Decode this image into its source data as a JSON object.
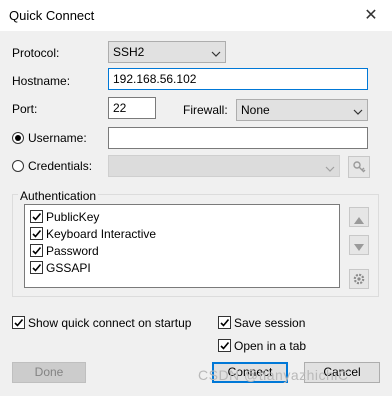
{
  "window": {
    "title": "Quick Connect"
  },
  "protocol": {
    "label": "Protocol:",
    "value": "SSH2"
  },
  "hostname": {
    "label": "Hostname:",
    "value": "192.168.56.102"
  },
  "port": {
    "label": "Port:",
    "value": "22"
  },
  "firewall": {
    "label": "Firewall:",
    "value": "None"
  },
  "username": {
    "label": "Username:",
    "value": ""
  },
  "credentials": {
    "label": "Credentials:",
    "value": ""
  },
  "authentication": {
    "label": "Authentication",
    "methods": [
      {
        "label": "PublicKey",
        "checked": true
      },
      {
        "label": "Keyboard Interactive",
        "checked": true
      },
      {
        "label": "Password",
        "checked": true
      },
      {
        "label": "GSSAPI",
        "checked": true
      }
    ]
  },
  "options": {
    "show_quick_connect": "Show quick connect on startup",
    "save_session": "Save session",
    "open_in_tab": "Open in a tab"
  },
  "buttons": {
    "done": "Done",
    "connect": "Connect",
    "cancel": "Cancel"
  },
  "watermark": "CSDN @tianyazhichiC"
}
